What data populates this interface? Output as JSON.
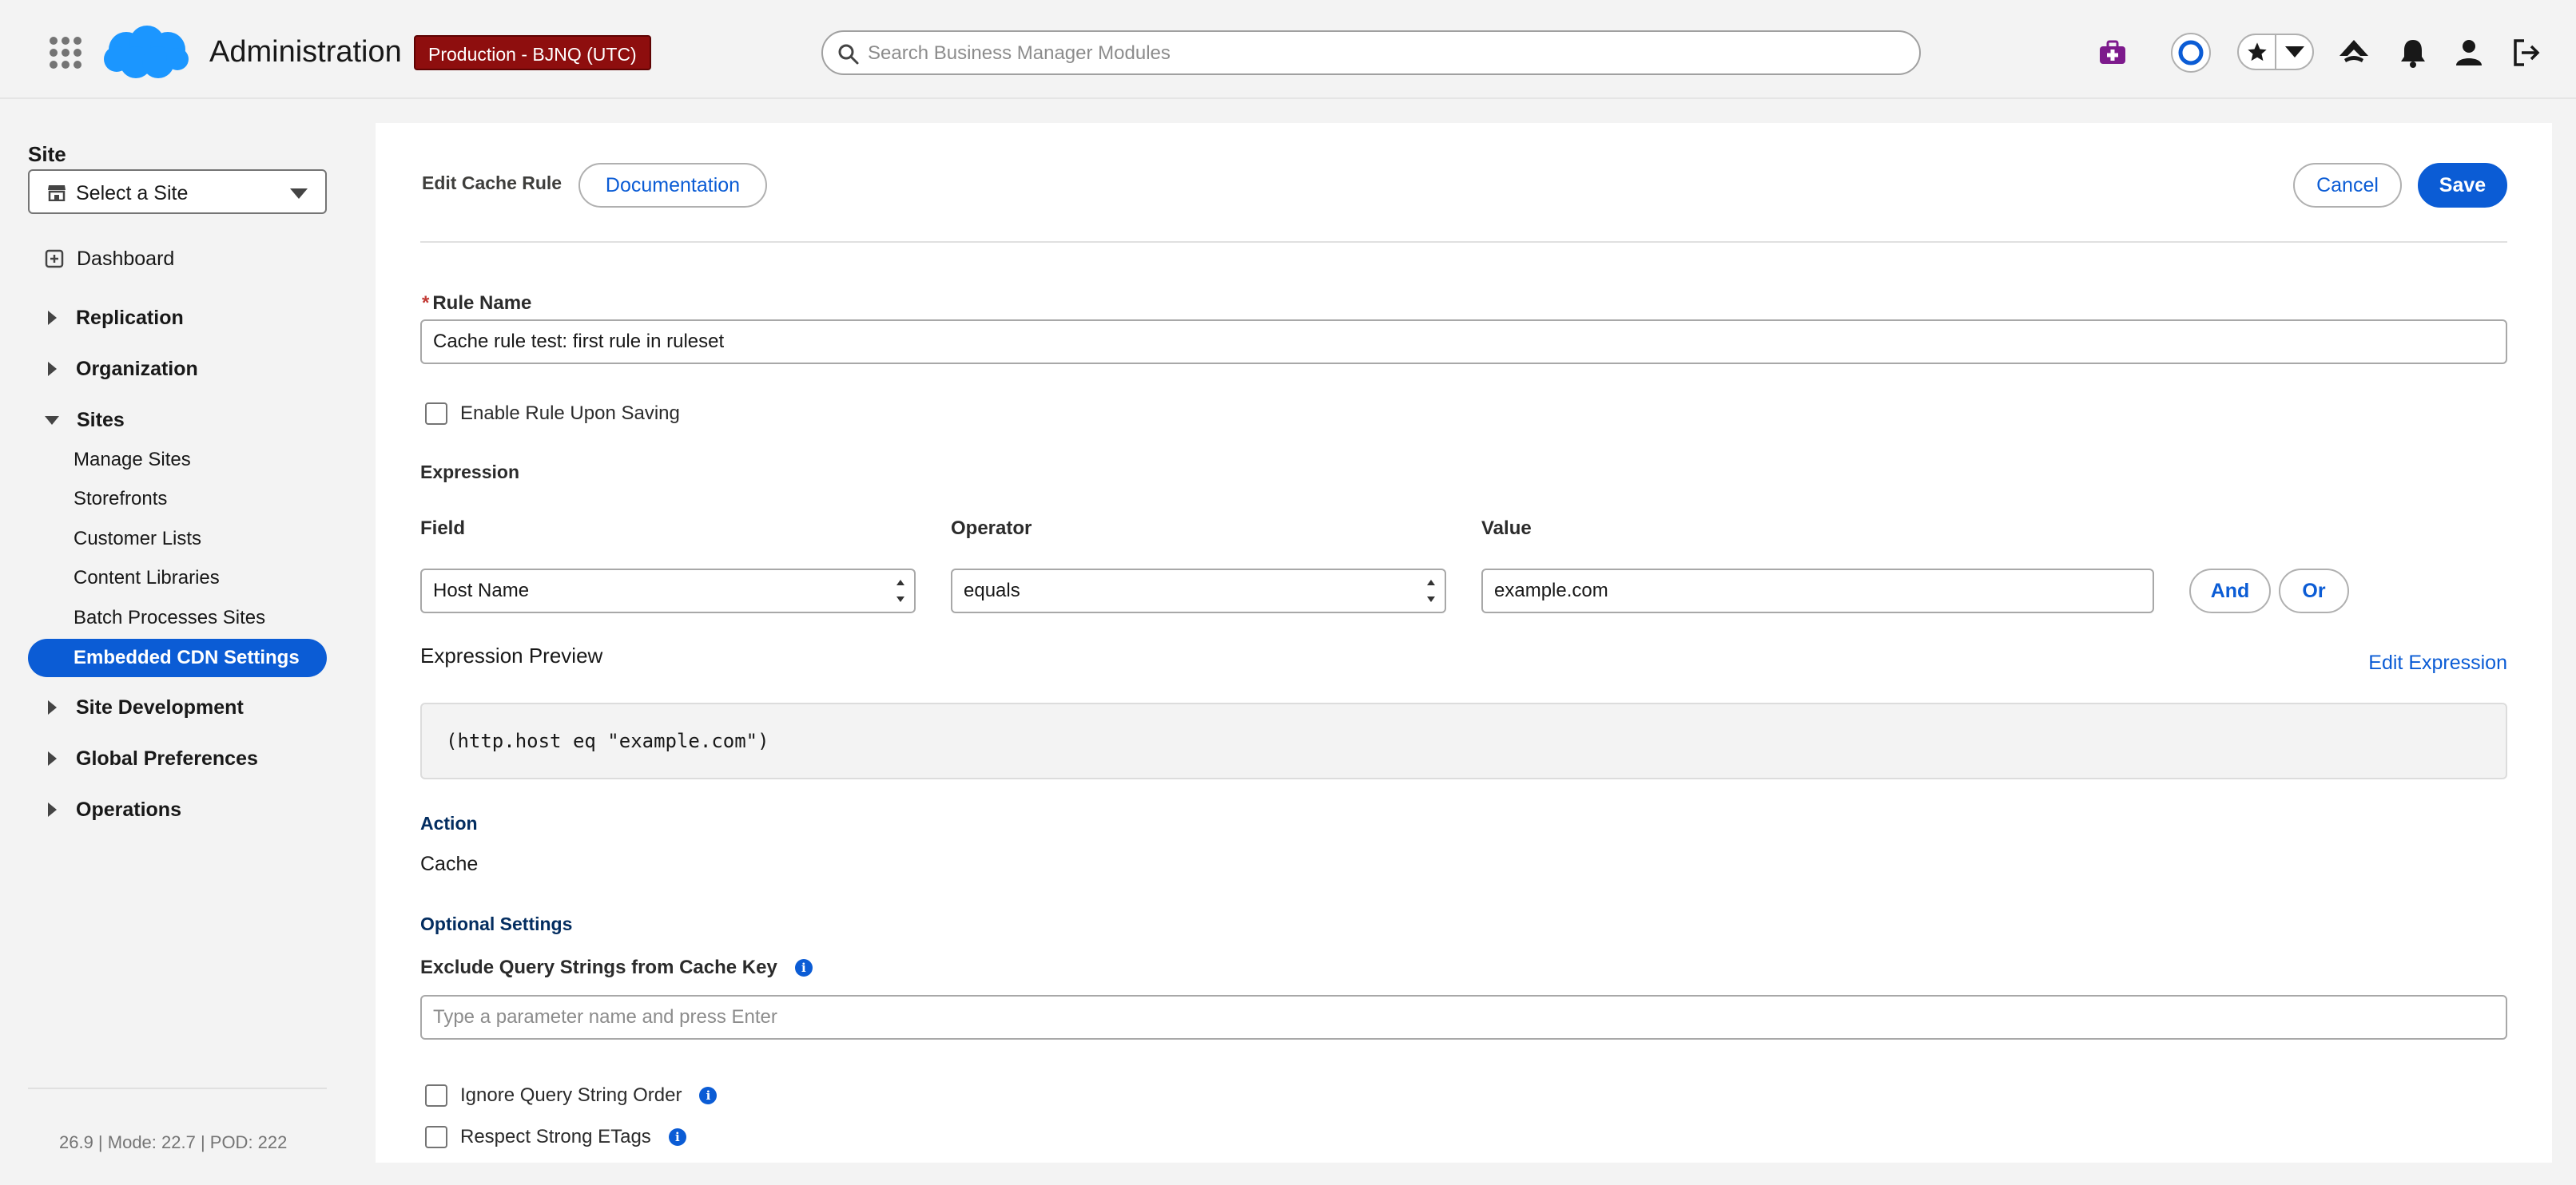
{
  "header": {
    "app_title": "Administration",
    "env_badge": "Production - BJNQ (UTC)",
    "search_placeholder": "Search Business Manager Modules",
    "brand_color": "#0b5cd5",
    "badge_color": "#8e0e0e"
  },
  "sidebar": {
    "site_label": "Site",
    "site_select": "Select a Site",
    "dashboard": "Dashboard",
    "sections": [
      {
        "label": "Replication"
      },
      {
        "label": "Organization"
      },
      {
        "label": "Sites"
      },
      {
        "label": "Site Development"
      },
      {
        "label": "Global Preferences"
      },
      {
        "label": "Operations"
      }
    ],
    "sites_items": [
      {
        "label": "Manage Sites"
      },
      {
        "label": "Storefronts"
      },
      {
        "label": "Customer Lists"
      },
      {
        "label": "Content Libraries"
      },
      {
        "label": "Batch Processes Sites"
      },
      {
        "label": "Embedded CDN Settings"
      }
    ],
    "version": "26.9 | Mode: 22.7 | POD: 222"
  },
  "main": {
    "page_title": "Edit Cache Rule",
    "documentation": "Documentation",
    "cancel": "Cancel",
    "save": "Save",
    "rule_name_label": "Rule Name",
    "required_mark": "*",
    "rule_name_value": "Cache rule test: first rule in ruleset",
    "enable_rule_label": "Enable Rule Upon Saving",
    "expression_heading": "Expression",
    "field_label": "Field",
    "operator_label": "Operator",
    "value_label": "Value",
    "field_value": "Host Name",
    "operator_value": "equals",
    "value_value": "example.com",
    "and_button": "And",
    "or_button": "Or",
    "expression_preview_label": "Expression Preview",
    "edit_expression": "Edit Expression",
    "expression_preview": "(http.host eq \"example.com\")",
    "action_heading": "Action",
    "action_value": "Cache",
    "optional_heading": "Optional Settings",
    "exclude_label": "Exclude Query Strings from Cache Key",
    "exclude_placeholder": "Type a parameter name and press Enter",
    "ignore_order_label": "Ignore Query String Order",
    "strong_etags_label": "Respect Strong ETags",
    "info_glyph": "i"
  }
}
